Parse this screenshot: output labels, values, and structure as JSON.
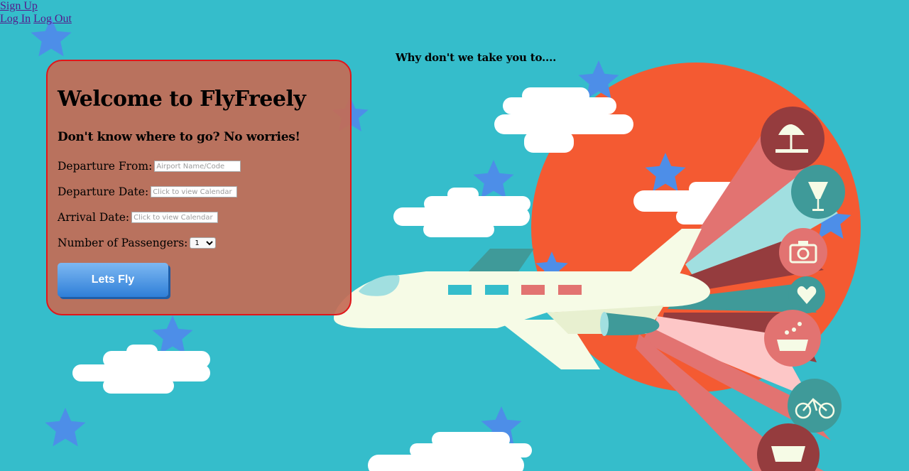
{
  "nav": {
    "signup": "Sign Up",
    "login": "Log In",
    "logout": "Log Out"
  },
  "tagline": "Why don't we take you to....",
  "panel": {
    "title": "Welcome to FlyFreely",
    "subtitle": "Don't know where to go? No worries!",
    "departure_from": {
      "label": "Departure From:",
      "placeholder": "Airport Name/Code"
    },
    "departure_date": {
      "label": "Departure Date:",
      "placeholder": "Click to view Calendar"
    },
    "arrival_date": {
      "label": "Arrival Date:",
      "placeholder": "Click to view Calendar"
    },
    "passengers": {
      "label": "Number of Passengers:",
      "value": "1"
    },
    "button": "Lets Fly"
  },
  "colors": {
    "background": "#35bdcb",
    "panel": "#c46c55",
    "panel_border": "#e0161a",
    "sun": "#f45a32",
    "plane": "#f6fbe6",
    "button": "#3d8ce0"
  }
}
